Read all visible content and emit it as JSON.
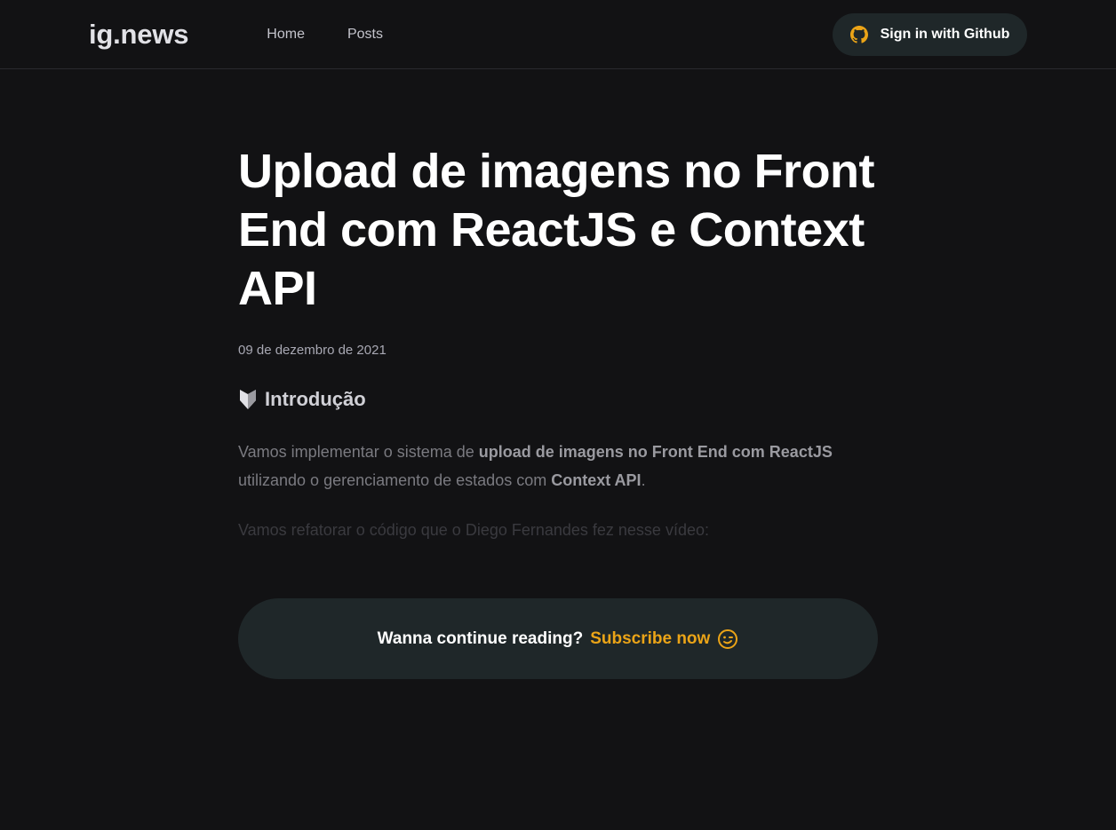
{
  "header": {
    "logo": "ig.news",
    "nav": [
      {
        "label": "Home"
      },
      {
        "label": "Posts"
      }
    ],
    "signin_label": "Sign in with Github",
    "github_icon": "github-icon"
  },
  "post": {
    "title": "Upload de imagens no Front End com ReactJS e Context API",
    "date": "09 de dezembro de 2021",
    "intro_icon": "badge-icon",
    "intro_heading": "Introdução",
    "paragraph1": {
      "t1": "Vamos implementar o sistema de ",
      "b1": "upload de imagens no Front End com ReactJS",
      "t2": " utilizando o gerenciamento de estados com ",
      "b2": "Context API",
      "t3": "."
    },
    "paragraph2": "Vamos refatorar o código que o Diego Fernandes fez nesse vídeo:"
  },
  "cta": {
    "text": "Wanna continue reading?",
    "link": "Subscribe now",
    "emoji_icon": "wink-face-icon"
  },
  "colors": {
    "background": "#121214",
    "accent": "#eba417",
    "button_bg": "#1f2729"
  }
}
